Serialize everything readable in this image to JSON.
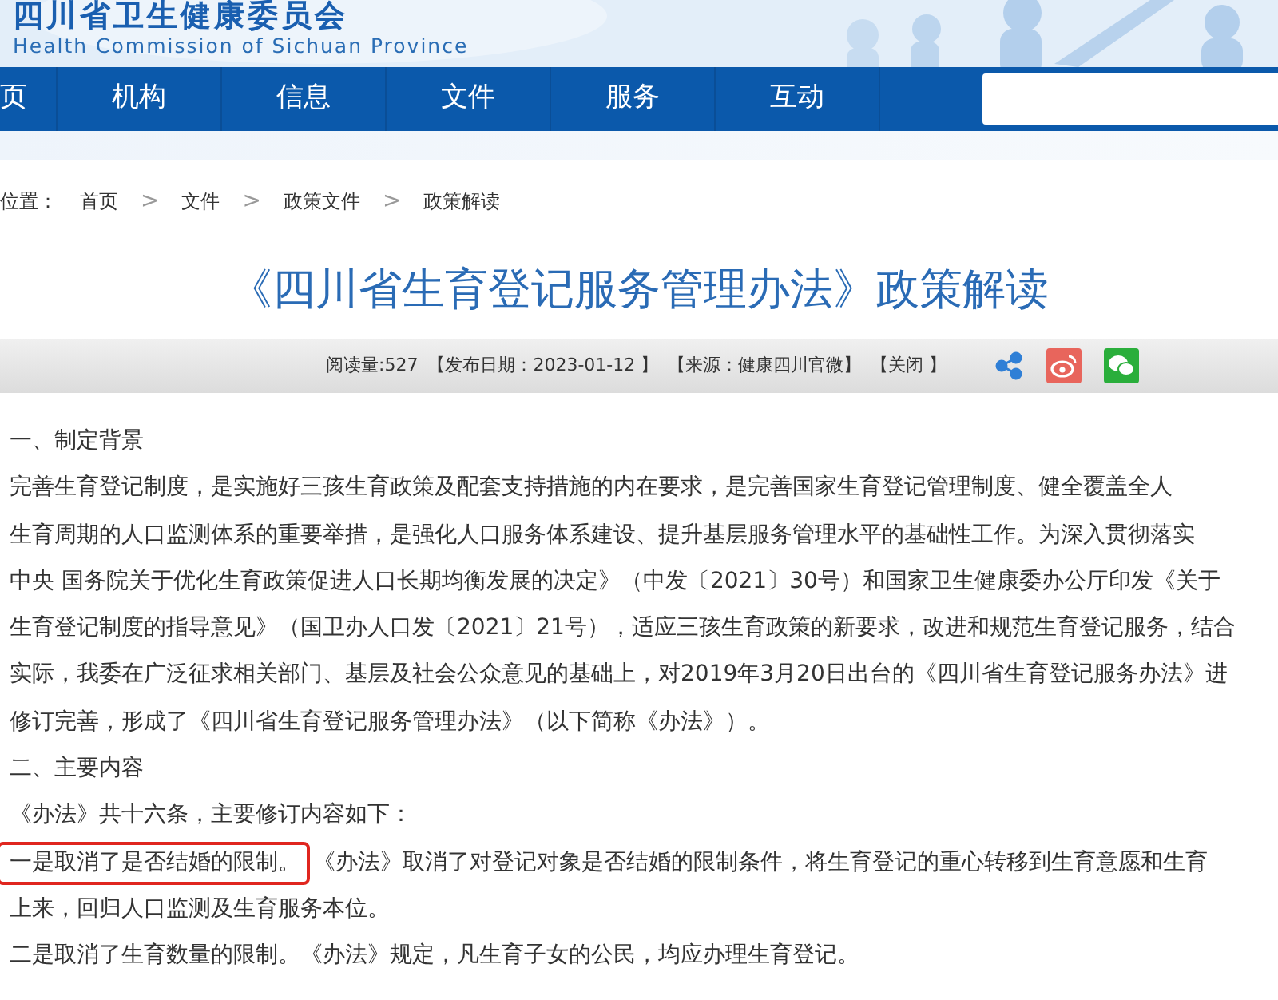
{
  "header": {
    "title": "四川省卫生健康委员会",
    "subtitle": "Health Commission of Sichuan Province"
  },
  "nav": {
    "items": [
      {
        "label": "页"
      },
      {
        "label": "机构"
      },
      {
        "label": "信息"
      },
      {
        "label": "文件"
      },
      {
        "label": "服务"
      },
      {
        "label": "互动"
      }
    ]
  },
  "breadcrumb": {
    "prefix": "位置：",
    "separator": ">",
    "items": [
      "首页",
      "文件",
      "政策文件",
      "政策解读"
    ]
  },
  "article": {
    "title": "《四川省生育登记服务管理办法》政策解读",
    "meta": [
      "阅读量:527",
      "【发布日期：2023-01-12 】",
      "【来源：健康四川官微】",
      "【关闭 】"
    ],
    "share": [
      {
        "kind": "share"
      },
      {
        "kind": "weibo"
      },
      {
        "kind": "wechat"
      }
    ],
    "lines": [
      {
        "segments": [
          {
            "text": "一、制定背景",
            "highlighted": false
          }
        ]
      },
      {
        "segments": [
          {
            "text": "完善生育登记制度，是实施好三孩生育政策及配套支持措施的内在要求，是完善国家生育登记管理制度、健全覆盖全人",
            "highlighted": false
          }
        ]
      },
      {
        "segments": [
          {
            "text": "生育周期的人口监测体系的重要举措，是强化人口服务体系建设、提升基层服务管理水平的基础性工作。为深入贯彻落实",
            "highlighted": false
          }
        ]
      },
      {
        "segments": [
          {
            "text": "中央 国务院关于优化生育政策促进人口长期均衡发展的决定》（中发〔2021〕30号）和国家卫生健康委办公厅印发《关于",
            "highlighted": false
          }
        ]
      },
      {
        "segments": [
          {
            "text": "生育登记制度的指导意见》（国卫办人口发〔2021〕21号），适应三孩生育政策的新要求，改进和规范生育登记服务，结合",
            "highlighted": false
          }
        ]
      },
      {
        "segments": [
          {
            "text": "实际，我委在广泛征求相关部门、基层及社会公众意见的基础上，对2019年3月20日出台的《四川省生育登记服务办法》进",
            "highlighted": false
          }
        ]
      },
      {
        "segments": [
          {
            "text": "修订完善，形成了《四川省生育登记服务管理办法》（以下简称《办法》）。",
            "highlighted": false
          }
        ]
      },
      {
        "segments": [
          {
            "text": "二、主要内容",
            "highlighted": false
          }
        ]
      },
      {
        "segments": [
          {
            "text": "《办法》共十六条，主要修订内容如下：",
            "highlighted": false
          }
        ]
      },
      {
        "segments": [
          {
            "text": "一是取消了是否结婚的限制。",
            "highlighted": true
          },
          {
            "text": "《办法》取消了对登记对象是否结婚的限制条件，将生育登记的重心转移到生育意愿和生育",
            "highlighted": false
          }
        ]
      },
      {
        "segments": [
          {
            "text": "上来，回归人口监测及生育服务本位。",
            "highlighted": false
          }
        ]
      },
      {
        "segments": [
          {
            "text": "二是取消了生育数量的限制。《办法》规定，凡生育子女的公民，均应办理生育登记。",
            "highlighted": false
          }
        ]
      }
    ]
  }
}
